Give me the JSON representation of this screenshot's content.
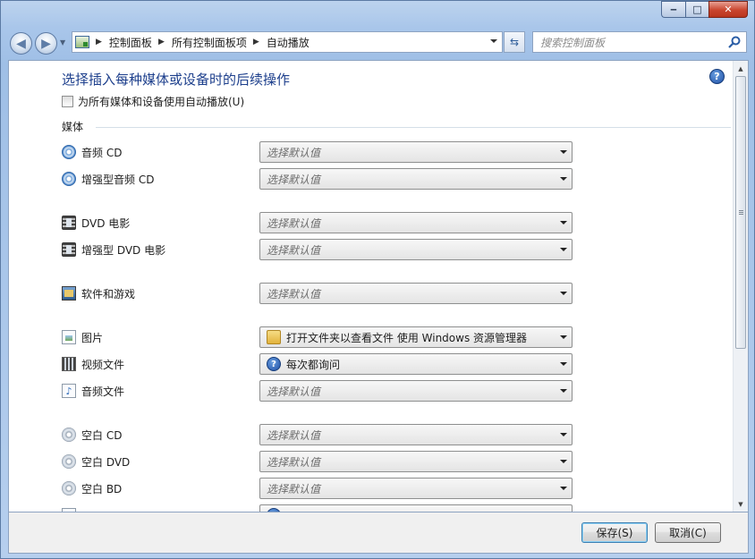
{
  "window": {
    "caption_buttons": {
      "minimize": "‒",
      "maximize": "□",
      "close": "✕"
    }
  },
  "nav": {
    "breadcrumbs": [
      "控制面板",
      "所有控制面板项",
      "自动播放"
    ],
    "search_placeholder": "搜索控制面板"
  },
  "main": {
    "title": "选择插入每种媒体或设备时的后续操作",
    "use_autoplay_checkbox": {
      "label": "为所有媒体和设备使用自动播放(U)",
      "checked": false
    },
    "section_label": "媒体",
    "default_placeholder": "选择默认值",
    "rows": [
      {
        "label": "音频 CD",
        "icon": "audio-cd-icon",
        "value": "选择默认值"
      },
      {
        "label": "增强型音频 CD",
        "icon": "enhanced-audio-cd-icon",
        "value": "选择默认值"
      },
      {
        "label": "DVD 电影",
        "icon": "dvd-movie-icon",
        "value": "选择默认值"
      },
      {
        "label": "增强型 DVD 电影",
        "icon": "enhanced-dvd-movie-icon",
        "value": "选择默认值"
      },
      {
        "label": "软件和游戏",
        "icon": "software-games-icon",
        "value": "选择默认值"
      },
      {
        "label": "图片",
        "icon": "pictures-icon",
        "value": "打开文件夹以查看文件 使用 Windows 资源管理器",
        "value_icon": "folder-icon"
      },
      {
        "label": "视频文件",
        "icon": "video-files-icon",
        "value": "每次都询问",
        "value_icon": "question-icon"
      },
      {
        "label": "音频文件",
        "icon": "audio-files-icon",
        "value": "选择默认值"
      },
      {
        "label": "空白 CD",
        "icon": "blank-cd-icon",
        "value": "选择默认值"
      },
      {
        "label": "空白 DVD",
        "icon": "blank-dvd-icon",
        "value": "选择默认值"
      },
      {
        "label": "空白 BD",
        "icon": "blank-bd-icon",
        "value": "选择默认值"
      }
    ]
  },
  "footer": {
    "save_label": "保存(S)",
    "cancel_label": "取消(C)"
  }
}
